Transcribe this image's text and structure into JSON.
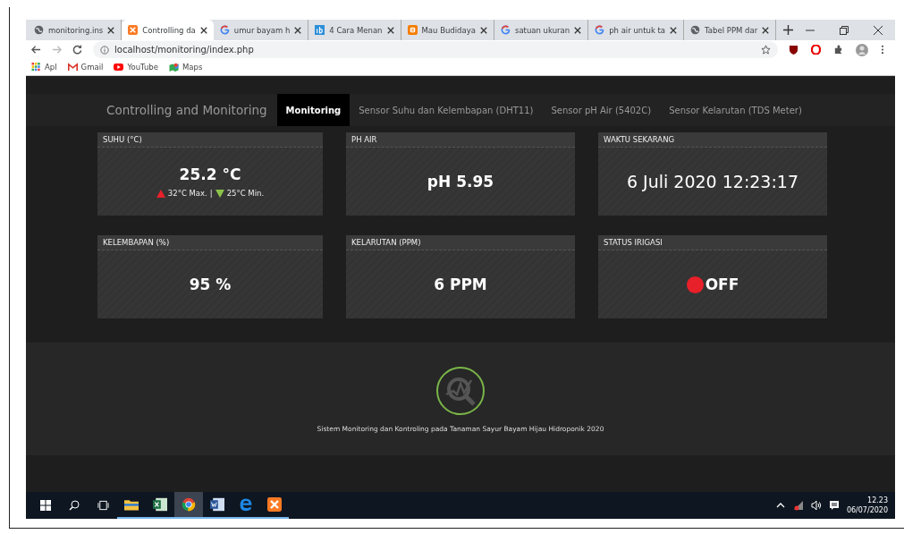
{
  "browser": {
    "tabs": [
      {
        "title": "monitoring.ins",
        "selected": false
      },
      {
        "title": "Controlling da",
        "selected": true
      },
      {
        "title": "umur bayam h",
        "selected": false
      },
      {
        "title": "4 Cara Menan",
        "selected": false
      },
      {
        "title": "Mau Budidaya",
        "selected": false
      },
      {
        "title": "satuan ukuran",
        "selected": false
      },
      {
        "title": "ph air untuk ta",
        "selected": false
      },
      {
        "title": "Tabel PPM dar",
        "selected": false
      }
    ],
    "address": "localhost/monitoring/index.php",
    "bookmarks": [
      {
        "label": "Apl"
      },
      {
        "label": "Gmail"
      },
      {
        "label": "YouTube"
      },
      {
        "label": "Maps"
      }
    ]
  },
  "navbar": {
    "brand": "Controlling and Monitoring",
    "items": [
      {
        "label": "Monitoring",
        "selected": true
      },
      {
        "label": "Sensor Suhu dan Kelembapan (DHT11)",
        "selected": false
      },
      {
        "label": "Sensor pH Air (5402C)",
        "selected": false
      },
      {
        "label": "Sensor Kelarutan (TDS Meter)",
        "selected": false
      }
    ]
  },
  "cards": [
    {
      "kind": "range",
      "title": "SUHU (°C)",
      "value": "25.2 °C",
      "max": "32°C Max.",
      "separator": "|",
      "min": "25°C Min."
    },
    {
      "kind": "value",
      "title": "PH AIR",
      "value": "pH 5.95"
    },
    {
      "kind": "clock",
      "title": "WAKTU SEKARANG",
      "value": "6 Juli 2020 12:23:17"
    },
    {
      "kind": "value",
      "title": "KELEMBAPAN (%)",
      "value": "95 %"
    },
    {
      "kind": "value",
      "title": "KELARUTAN (PPM)",
      "value": "6 PPM"
    },
    {
      "kind": "status",
      "title": "STATUS IRIGASI",
      "value": "OFF",
      "on": false
    }
  ],
  "footer": {
    "text": "Sistem Monitoring dan Kontroling pada Tanaman Sayur Bayam Hijau Hidroponik 2020"
  },
  "taskbar": {
    "apps": [
      {
        "selected": false
      },
      {
        "selected": false
      },
      {
        "selected": true
      },
      {
        "selected": false
      },
      {
        "selected": false
      },
      {
        "selected": false
      }
    ],
    "time": "12.23",
    "date": "06/07/2020"
  }
}
